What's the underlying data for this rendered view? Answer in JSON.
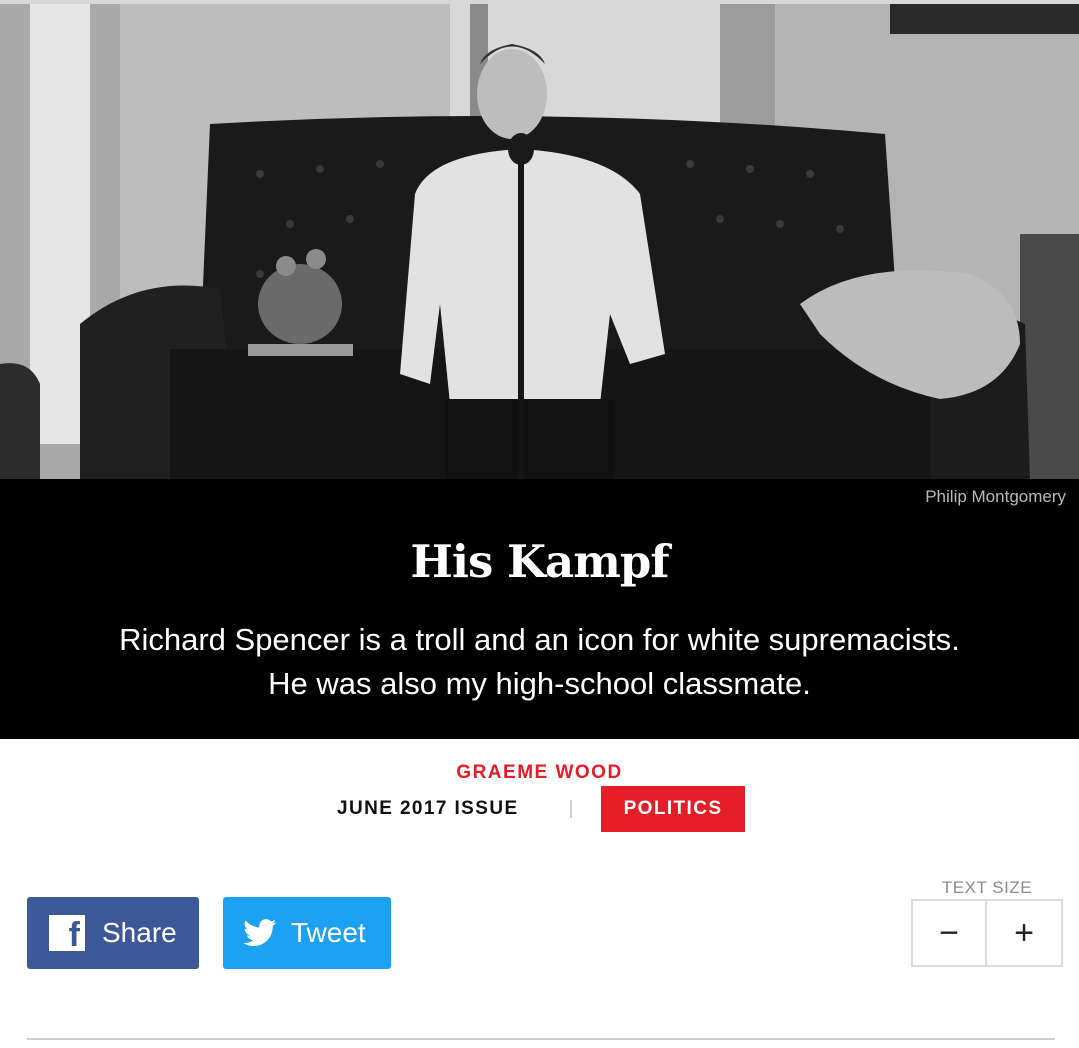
{
  "hero": {
    "credit": "Philip Montgomery"
  },
  "article": {
    "headline": "His Kampf",
    "dek_line1": "Richard Spencer is a troll and an icon for white supremacists.",
    "dek_line2": "He was also my high-school classmate.",
    "author": "GRAEME WOOD",
    "issue": "JUNE 2017 ISSUE",
    "section": "POLITICS"
  },
  "share": {
    "facebook_label": "Share",
    "facebook_icon": "facebook-icon",
    "twitter_label": "Tweet",
    "twitter_icon": "twitter-bird-icon"
  },
  "text_size": {
    "label": "TEXT SIZE",
    "decrease": "−",
    "increase": "+"
  },
  "colors": {
    "accent_red": "#e41d27",
    "facebook_blue": "#3b5998",
    "twitter_blue": "#1da1f2"
  }
}
